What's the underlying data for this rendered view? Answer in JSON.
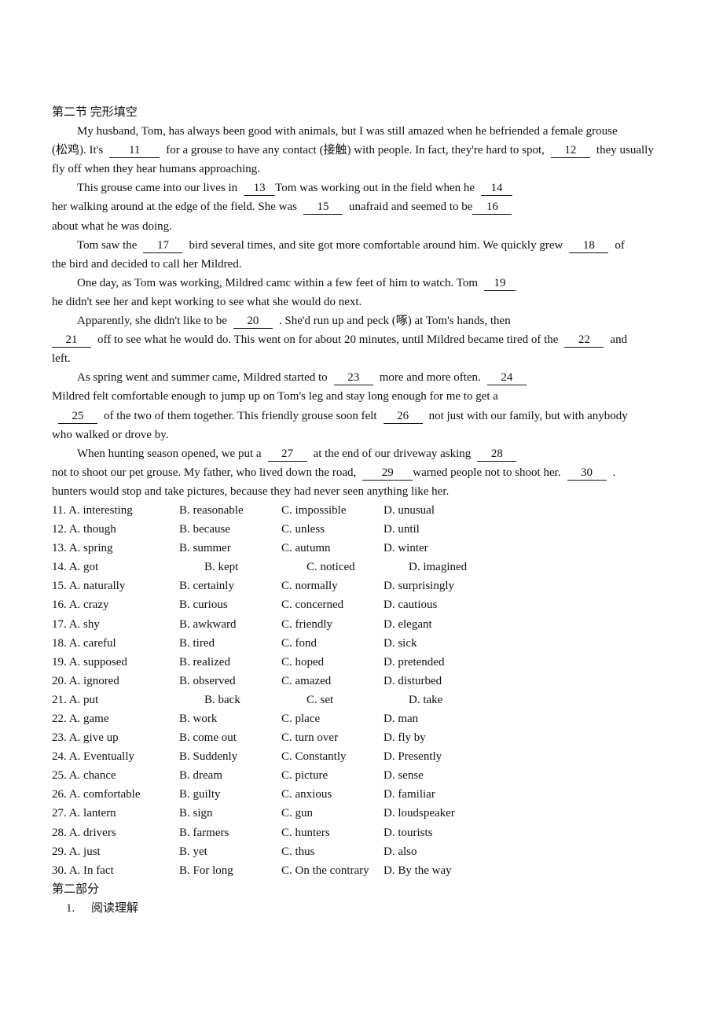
{
  "section_title": "第二节 完形填空",
  "passage": {
    "p1": {
      "l1": "My husband, Tom, has always been good with animals, but I was still amazed when he befriended a female grouse",
      "l2a": "(松鸡). It's",
      "b11": "11",
      "l2b": "for a grouse to have any contact (接触) with people. In fact, they're hard to spot,",
      "b12": "12",
      "l2c": "they usually",
      "l3": "fly off when they hear humans approaching."
    },
    "p2": {
      "l1a": "This grouse came into our lives in",
      "b13": "13",
      "l1b": "Tom was working out in the field when he",
      "b14": "14",
      "l2a": "her walking around at the edge of the field. She was",
      "b15": "15",
      "l2b": "unafraid and seemed to be",
      "b16": "16",
      "l3": "about what he was doing."
    },
    "p3": {
      "l1a": "Tom saw the",
      "b17": "17",
      "l1b": "bird several times, and site got more comfortable around him. We quickly grew",
      "b18": "18",
      "l1c": "of",
      "l2": "the bird and decided to call her Mildred."
    },
    "p4": {
      "l1a": "One day, as Tom was working, Mildred camc within a few feet of him to watch. Tom",
      "b19": "19",
      "l2": "he didn't see her and kept working to see what she would do next."
    },
    "p5": {
      "l1a": "Apparently, she didn't like to be",
      "b20": "20",
      "l1b": ". She'd run up and peck (啄) at Tom's hands, then",
      "b21": "21",
      "l2a": "off to see what he would do. This went on for about 20 minutes, until Mildred became tired of the",
      "b22": "22",
      "l2b": "and",
      "l3": "left."
    },
    "p6": {
      "l1a": "As spring went and summer came, Mildred started to",
      "b23": "23",
      "l1b": "more and more often.",
      "b24": "24",
      "l2": "Mildred felt comfortable enough to jump up on Tom's leg and stay long enough for me to get a",
      "b25": "25",
      "l3a": "of the two of them together. This friendly grouse soon felt",
      "b26": "26",
      "l3b": "not just with our family, but with anybody",
      "l4": "who walked or drove by."
    },
    "p7": {
      "l1a": "When hunting season opened, we put a",
      "b27": "27",
      "l1b": "at the end of our driveway asking",
      "b28": "28",
      "l2a": "not to shoot our pet grouse. My father, who lived down the road,",
      "b29": "29",
      "l2b": "warned people not to shoot her.",
      "b30": "30",
      "l2c": ".",
      "l3": "hunters would stop and take pictures, because they had never seen anything like her."
    }
  },
  "questions": [
    {
      "num": "11.",
      "a": "A. interesting",
      "b": "B. reasonable",
      "c": "C. impossible",
      "d": "D. unusual"
    },
    {
      "num": "12.",
      "a": "A. though",
      "b": "B. because",
      "c": "C. unless",
      "d": "D. until"
    },
    {
      "num": "13.",
      "a": "A. spring",
      "b": "B. summer",
      "c": "C. autumn",
      "d": "D. winter"
    },
    {
      "num": "14.",
      "a": "A. got",
      "b": "B. kept",
      "c": "C. noticed",
      "d": "D. imagined"
    },
    {
      "num": "15.",
      "a": "A. naturally",
      "b": "B. certainly",
      "c": "C. normally",
      "d": "D. surprisingly"
    },
    {
      "num": "16.",
      "a": "A. crazy",
      "b": "B. curious",
      "c": "C. concerned",
      "d": "D. cautious"
    },
    {
      "num": "17.",
      "a": "A. shy",
      "b": "B. awkward",
      "c": "C. friendly",
      "d": "D. elegant"
    },
    {
      "num": "18.",
      "a": "A. careful",
      "b": "B. tired",
      "c": "C. fond",
      "d": "D. sick"
    },
    {
      "num": "19.",
      "a": "A. supposed",
      "b": "B. realized",
      "c": "C. hoped",
      "d": "D. pretended"
    },
    {
      "num": "20.",
      "a": "A. ignored",
      "b": "B. observed",
      "c": "C. amazed",
      "d": "D. disturbed"
    },
    {
      "num": "21.",
      "a": "A. put",
      "b": "B. back",
      "c": "C. set",
      "d": "D. take"
    },
    {
      "num": "22.",
      "a": "A. game",
      "b": "B. work",
      "c": "C. place",
      "d": "D. man"
    },
    {
      "num": "23.",
      "a": "A. give up",
      "b": "B. come out",
      "c": "C. turn over",
      "d": "D. fly by"
    },
    {
      "num": "24.",
      "a": "A. Eventually",
      "b": "B. Suddenly",
      "c": "C. Constantly",
      "d": "D. Presently"
    },
    {
      "num": "25.",
      "a": "A. chance",
      "b": "B. dream",
      "c": "C. picture",
      "d": "D. sense"
    },
    {
      "num": "26.",
      "a": "A. comfortable",
      "b": "B. guilty",
      "c": "C. anxious",
      "d": "D. familiar"
    },
    {
      "num": "27.",
      "a": "A. lantern",
      "b": "B. sign",
      "c": "C. gun",
      "d": "D. loudspeaker"
    },
    {
      "num": "28.",
      "a": "A. drivers",
      "b": "B. farmers",
      "c": "C. hunters",
      "d": "D. tourists"
    },
    {
      "num": "29.",
      "a": "A. just",
      "b": "B. yet",
      "c": "C. thus",
      "d": "D. also"
    },
    {
      "num": "30.",
      "a": "A. In fact",
      "b": "B. For long",
      "c": "C. On the contrary",
      "d": "D. By the way"
    }
  ],
  "part_two": {
    "title": "第二部分",
    "item_num": "1.",
    "item_label": "阅读理解"
  }
}
